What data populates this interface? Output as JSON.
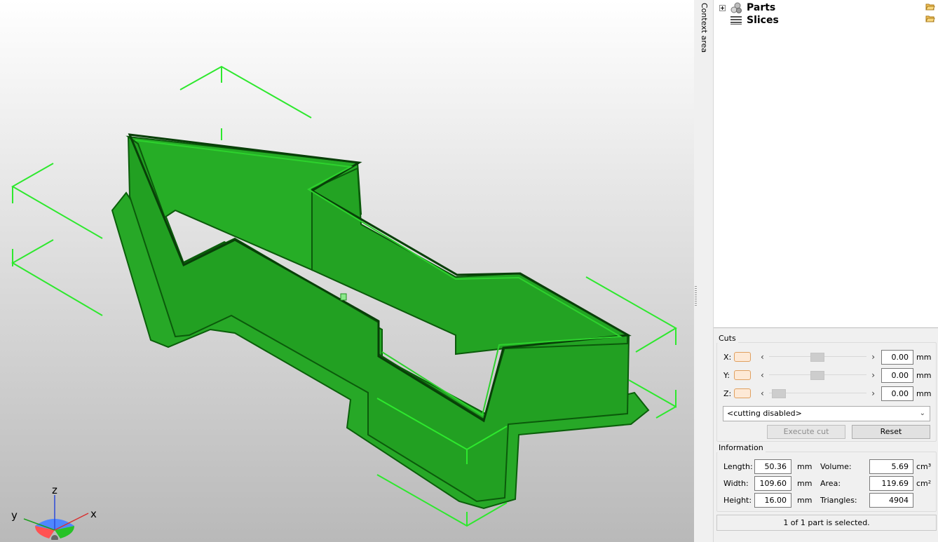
{
  "viewport": {
    "axis_labels": {
      "x": "x",
      "y": "y",
      "z": "z"
    },
    "colors": {
      "model": "#1fb51f",
      "model_dark": "#0a5f0a",
      "bbox": "#2ee82e"
    }
  },
  "sidebar": {
    "context_label": "Context area"
  },
  "tree": {
    "items": [
      {
        "label": "Parts",
        "icon": "spheres-icon"
      },
      {
        "label": "Slices",
        "icon": "layers-icon"
      }
    ]
  },
  "cuts": {
    "title": "Cuts",
    "axes": [
      {
        "label": "X:",
        "value": "0.00",
        "unit": "mm"
      },
      {
        "label": "Y:",
        "value": "0.00",
        "unit": "mm"
      },
      {
        "label": "Z:",
        "value": "0.00",
        "unit": "mm"
      }
    ],
    "mode": "<cutting disabled>",
    "execute_label": "Execute cut",
    "reset_label": "Reset"
  },
  "information": {
    "title": "Information",
    "length": {
      "label": "Length:",
      "value": "50.36",
      "unit": "mm"
    },
    "width": {
      "label": "Width:",
      "value": "109.60",
      "unit": "mm"
    },
    "height": {
      "label": "Height:",
      "value": "16.00",
      "unit": "mm"
    },
    "volume": {
      "label": "Volume:",
      "value": "5.69",
      "unit": "cm³"
    },
    "area": {
      "label": "Area:",
      "value": "119.69",
      "unit": "cm²"
    },
    "triangles": {
      "label": "Triangles:",
      "value": "4904"
    }
  },
  "status": {
    "text": "1 of 1 part is selected."
  }
}
